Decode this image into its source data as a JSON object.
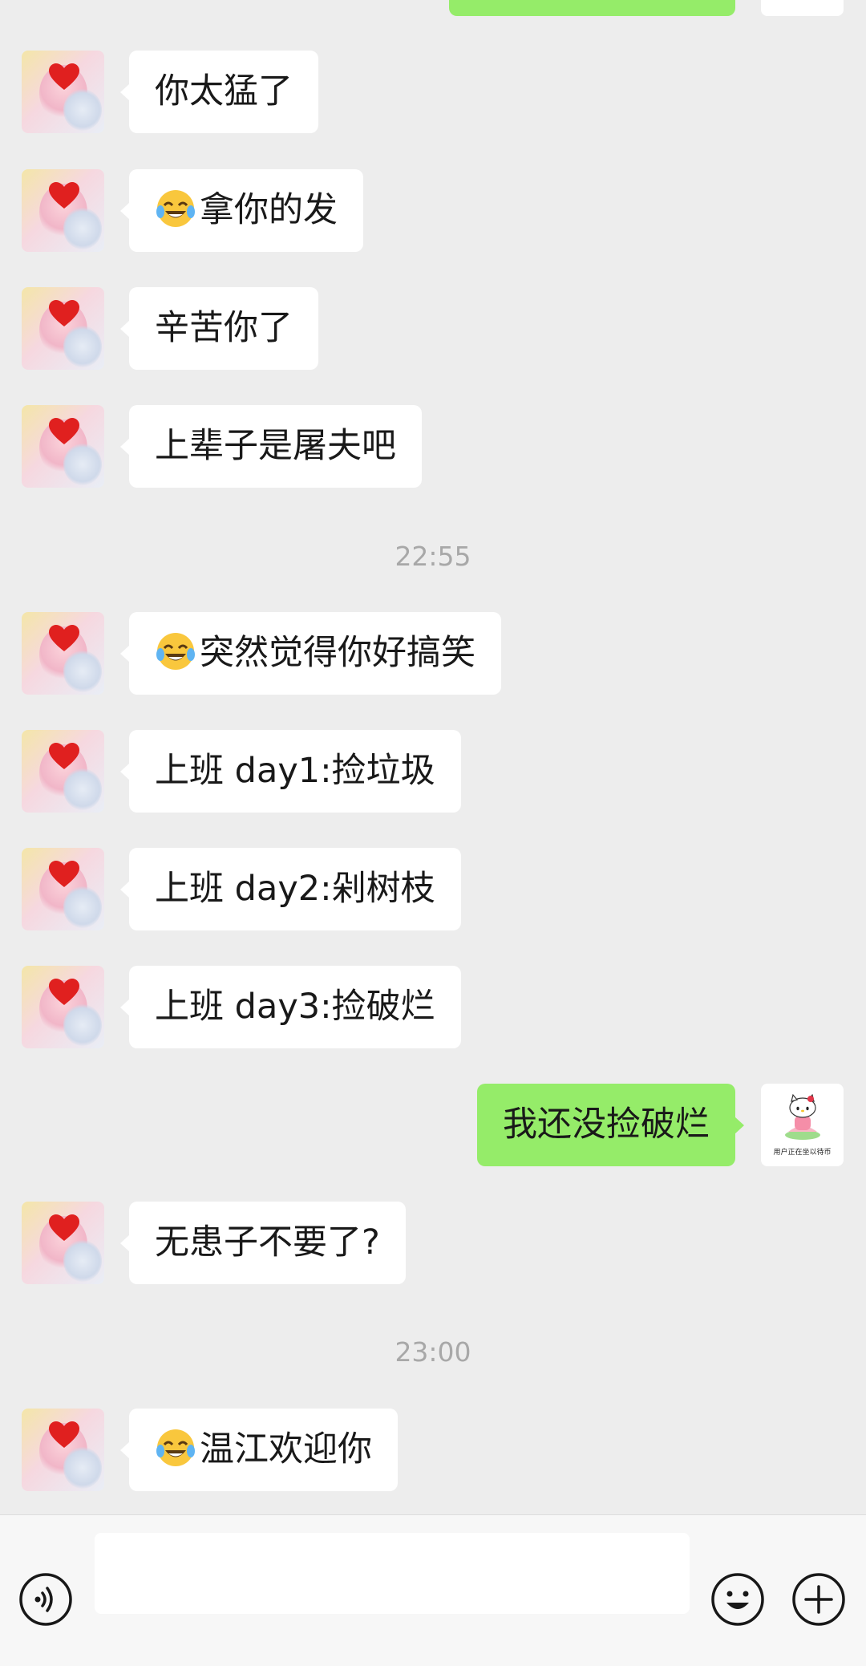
{
  "colors": {
    "background": "#ededed",
    "incoming_bubble": "#ffffff",
    "outgoing_bubble": "#95ec69",
    "timestamp": "#a8a8a8",
    "input_bar": "#f7f7f7"
  },
  "messages": [
    {
      "type": "incoming",
      "text": "你太猛了",
      "emoji": ""
    },
    {
      "type": "incoming",
      "text": "拿你的发",
      "emoji": "tears-of-joy-emoji"
    },
    {
      "type": "incoming",
      "text": "辛苦你了",
      "emoji": ""
    },
    {
      "type": "incoming",
      "text": "上辈子是屠夫吧",
      "emoji": ""
    },
    {
      "type": "timestamp",
      "text": "22:55"
    },
    {
      "type": "incoming",
      "text": "突然觉得你好搞笑",
      "emoji": "tears-of-joy-emoji"
    },
    {
      "type": "incoming",
      "text": "上班 day1:捡垃圾",
      "emoji": ""
    },
    {
      "type": "incoming",
      "text": "上班 day2:剁树枝",
      "emoji": ""
    },
    {
      "type": "incoming",
      "text": "上班 day3:捡破烂",
      "emoji": ""
    },
    {
      "type": "outgoing",
      "text": "我还没捡破烂"
    },
    {
      "type": "incoming",
      "text": "无患子不要了?",
      "emoji": ""
    },
    {
      "type": "timestamp",
      "text": "23:00"
    },
    {
      "type": "incoming",
      "text": "温江欢迎你",
      "emoji": "tears-of-joy-emoji"
    }
  ],
  "my_avatar": {
    "caption": "用户正在坐以待币",
    "icon": "hello-kitty-avatar"
  },
  "input_bar": {
    "voice_icon": "voice-icon",
    "input_value": "",
    "emoji_icon": "emoji-icon",
    "plus_icon": "plus-icon"
  }
}
